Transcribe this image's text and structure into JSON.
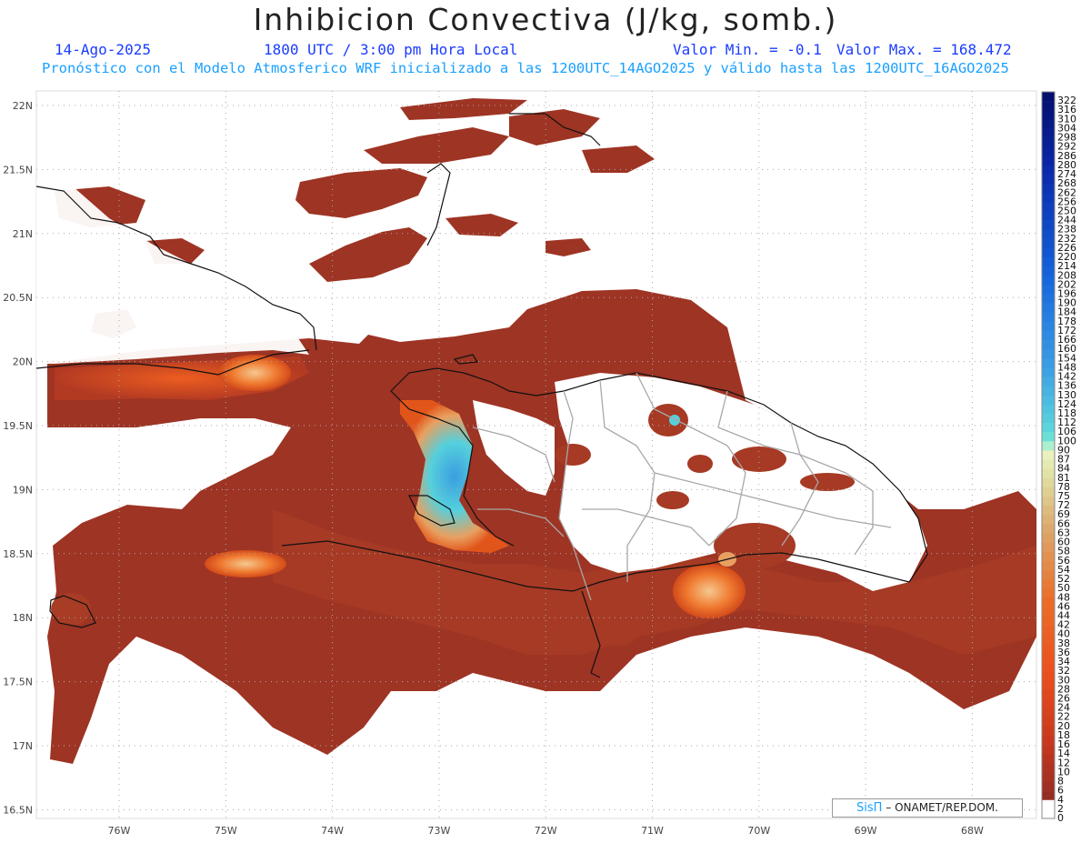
{
  "header": {
    "title": "Inhibicion Convectiva (J/kg, somb.)",
    "date": "14-Ago-2025",
    "time": "1800 UTC / 3:00 pm Hora Local",
    "valmin": "Valor Min. = -0.1",
    "valmax": "Valor Max. = 168.472",
    "forecast": "Pronóstico con el Modelo Atmosferico WRF inicializado a las 1200UTC_14AGO2025 y válido hasta las  1200UTC_16AGO2025"
  },
  "map": {
    "lat_labels": [
      "22N",
      "21.5N",
      "21N",
      "20.5N",
      "20N",
      "19.5N",
      "19N",
      "18.5N",
      "18N",
      "17.5N",
      "17N",
      "16.5N"
    ],
    "lon_labels": [
      "76W",
      "75W",
      "74W",
      "73W",
      "72W",
      "71W",
      "70W",
      "69W",
      "68W"
    ],
    "lat_range": [
      16.5,
      22
    ],
    "lon_range": [
      -76,
      -68
    ],
    "region_labels": []
  },
  "colorbar": {
    "labels": [
      "322",
      "316",
      "310",
      "304",
      "298",
      "292",
      "286",
      "280",
      "274",
      "268",
      "262",
      "256",
      "250",
      "244",
      "238",
      "232",
      "226",
      "220",
      "214",
      "208",
      "202",
      "196",
      "190",
      "184",
      "178",
      "172",
      "166",
      "160",
      "154",
      "148",
      "142",
      "136",
      "130",
      "124",
      "118",
      "112",
      "106",
      "100",
      "90",
      "87",
      "84",
      "81",
      "78",
      "75",
      "72",
      "69",
      "66",
      "63",
      "60",
      "58",
      "56",
      "54",
      "52",
      "50",
      "48",
      "46",
      "44",
      "42",
      "40",
      "38",
      "36",
      "34",
      "32",
      "30",
      "28",
      "26",
      "24",
      "22",
      "20",
      "18",
      "16",
      "14",
      "12",
      "10",
      "8",
      "6",
      "4",
      "2",
      "0"
    ]
  },
  "credit": {
    "sis": "SisΠ",
    "text": " – ONAMET/REP.DOM."
  },
  "colors": {
    "field_main": "#9e3424",
    "field_orange": "#e2551a",
    "field_light": "#f0a060",
    "field_cyan": "#4fd0e0",
    "field_blue": "#3fa0e0",
    "coast": "#111111",
    "border": "#a8a8a8"
  }
}
